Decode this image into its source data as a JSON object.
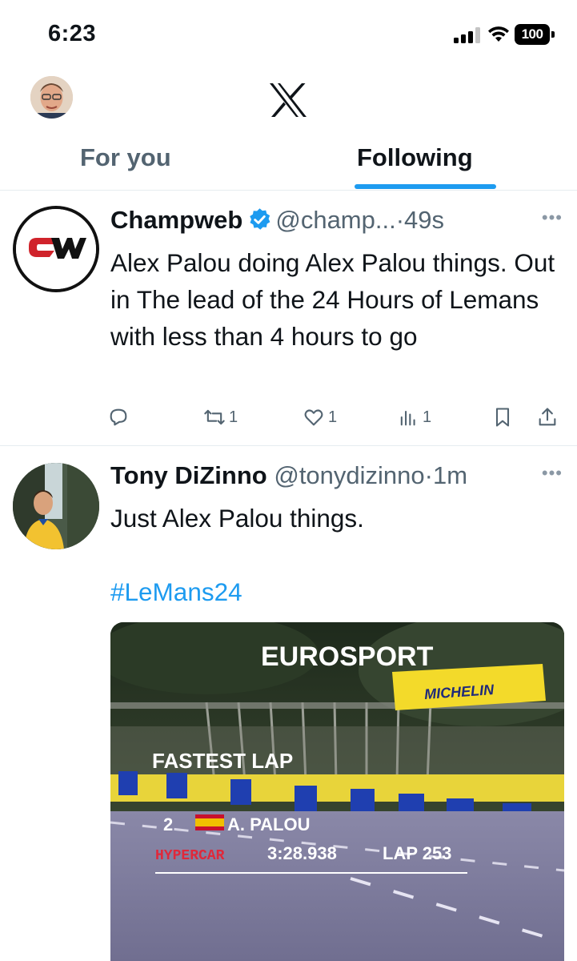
{
  "status_bar": {
    "time": "6:23",
    "battery": "100"
  },
  "header": {
    "logo": "x-logo"
  },
  "tabs": [
    {
      "label": "For you",
      "active": false
    },
    {
      "label": "Following",
      "active": true
    }
  ],
  "tweets": [
    {
      "name": "Champweb",
      "verified": true,
      "handle": "@champ...",
      "time": "·49s",
      "text": "Alex Palou doing Alex Palou things. Out in The lead of the 24 Hours of Lemans with less than 4 hours to go",
      "avatar_logo": "CW",
      "actions": {
        "reply": "",
        "retweets": "1",
        "likes": "1",
        "views": "1"
      }
    },
    {
      "name": "Tony DiZinno",
      "verified": false,
      "handle": "@tonydizinno",
      "time": "·1m",
      "text": "Just Alex Palou things.",
      "hashtag": "#LeMans24",
      "media": {
        "broadcaster": "EUROSPORT",
        "sponsor": "MICHELIN",
        "overlay_title": "FASTEST LAP",
        "position": "2",
        "driver": "A. PALOU",
        "class": "HYPERCAR",
        "lap_time": "3:28.938",
        "lap": "LAP 253"
      }
    }
  ],
  "colors": {
    "accent": "#1d9bf0",
    "text": "#0f1419",
    "secondary": "#536471"
  }
}
